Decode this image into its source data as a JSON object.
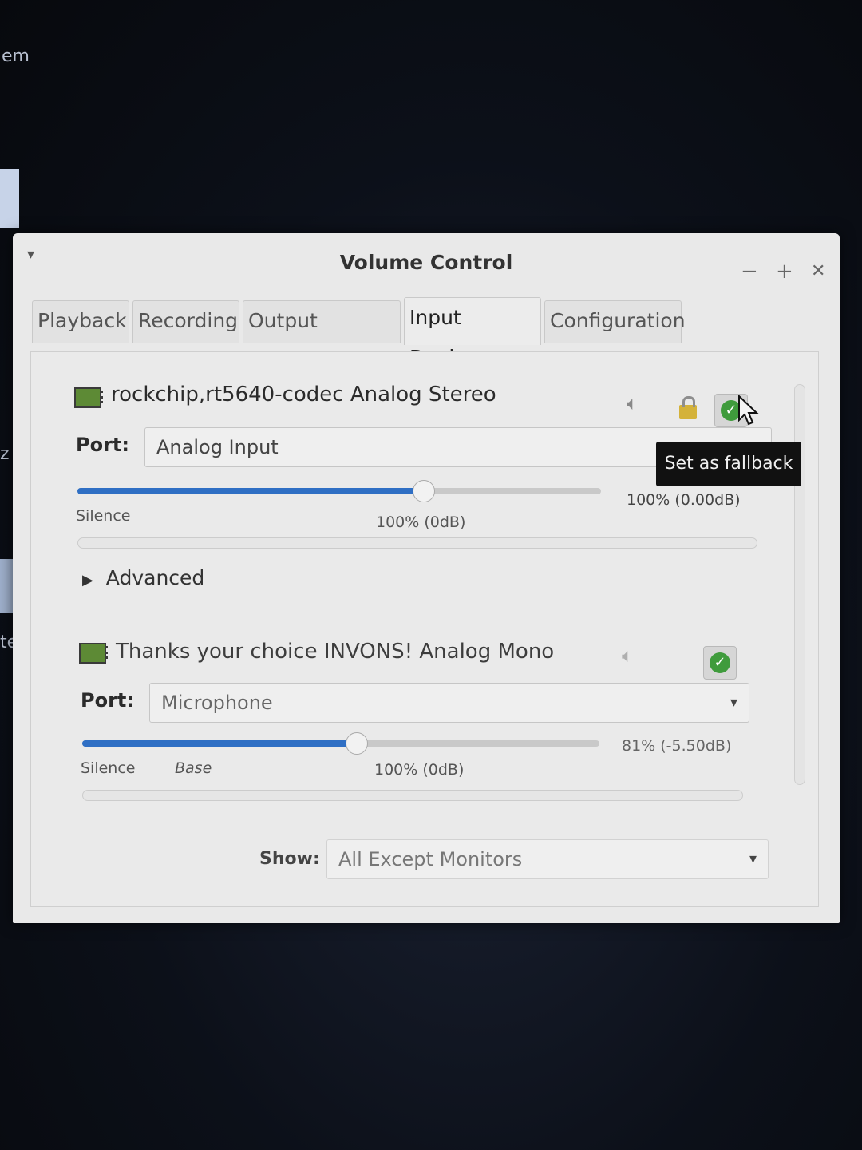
{
  "window": {
    "title": "Volume Control",
    "menu_icon": "▾",
    "controls": {
      "minimize": "−",
      "maximize": "+",
      "close": "✕"
    }
  },
  "tabs": [
    {
      "label": "Playback",
      "active": false
    },
    {
      "label": "Recording",
      "active": false
    },
    {
      "label": "Output Devices",
      "active": false
    },
    {
      "label": "Input Devices",
      "active": true
    },
    {
      "label": "Configuration",
      "active": false
    }
  ],
  "devices": [
    {
      "name": "rockchip,rt5640-codec Analog Stereo",
      "port_label": "Port:",
      "port_value": "Analog Input",
      "volume_text": "100% (0.00dB)",
      "volume_fraction": 0.66,
      "marks": {
        "silence": "Silence",
        "base": "",
        "hundred": "100% (0dB)"
      },
      "fallback": true,
      "advanced_label": "Advanced"
    },
    {
      "name": "Thanks your choice INVONS! Analog Mono",
      "port_label": "Port:",
      "port_value": "Microphone",
      "volume_text": "81% (-5.50dB)",
      "volume_fraction": 0.53,
      "marks": {
        "silence": "Silence",
        "base": "Base",
        "hundred": "100% (0dB)"
      },
      "fallback": true
    }
  ],
  "tooltip": "Set as fallback",
  "show": {
    "label": "Show:",
    "value": "All Except Monitors"
  },
  "desktop": {
    "fragment_1": "em",
    "fragment_2": "z",
    "fragment_3": "te"
  }
}
